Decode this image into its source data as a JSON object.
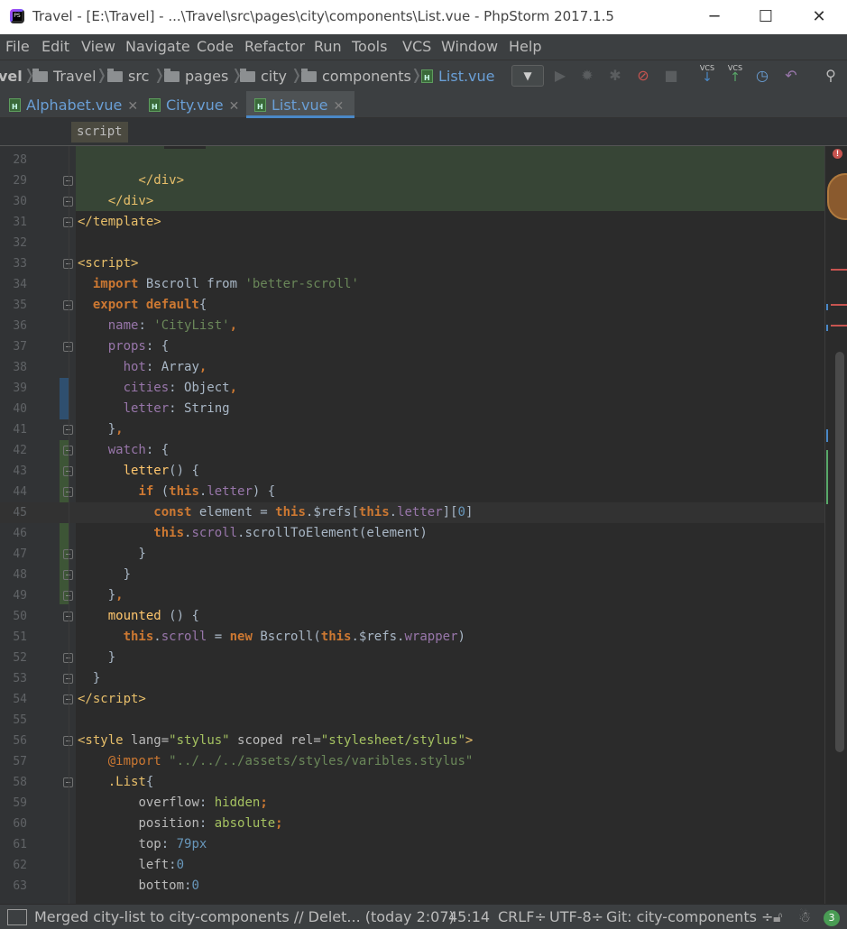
{
  "window": {
    "title": "Travel - [E:\\Travel] - ...\\Travel\\src\\pages\\city\\components\\List.vue - PhpStorm 2017.1.5",
    "icon_label": "PS",
    "minimize": "─",
    "maximize": "☐",
    "close": "✕"
  },
  "menu": [
    "File",
    "Edit",
    "View",
    "Navigate",
    "Code",
    "Refactor",
    "Run",
    "Tools",
    "VCS",
    "Window",
    "Help"
  ],
  "nav": {
    "crumbs": [
      "vel",
      "Travel",
      "src",
      "pages",
      "city",
      "components",
      "List.vue"
    ],
    "vcs_label": "VCS"
  },
  "tabs": [
    {
      "label": "Alphabet.vue",
      "close": "✕"
    },
    {
      "label": "City.vue",
      "close": "✕"
    },
    {
      "label": "List.vue",
      "close": "✕"
    }
  ],
  "crumb_tag": "script",
  "code": {
    "line_numbers": [
      "28",
      "29",
      "30",
      "31",
      "32",
      "33",
      "34",
      "35",
      "36",
      "37",
      "38",
      "39",
      "40",
      "41",
      "42",
      "43",
      "44",
      "45",
      "46",
      "47",
      "48",
      "49",
      "50",
      "51",
      "52",
      "53",
      "54",
      "55",
      "56",
      "57",
      "58",
      "59",
      "60",
      "61",
      "62",
      "63"
    ]
  },
  "status": {
    "message": "Merged city-list to city-components // Delet... (today 2:07)",
    "position": "45:14",
    "line_sep": "CRLF÷",
    "encoding": "UTF-8÷",
    "branch": "Git: city-components ÷",
    "notifications": "3"
  },
  "colors": {
    "editor_bg": "#2b2b2b",
    "keyword": "#cc7832",
    "string": "#6a8759",
    "tag": "#e8bf6a",
    "property": "#9876aa",
    "number": "#6897bb"
  }
}
